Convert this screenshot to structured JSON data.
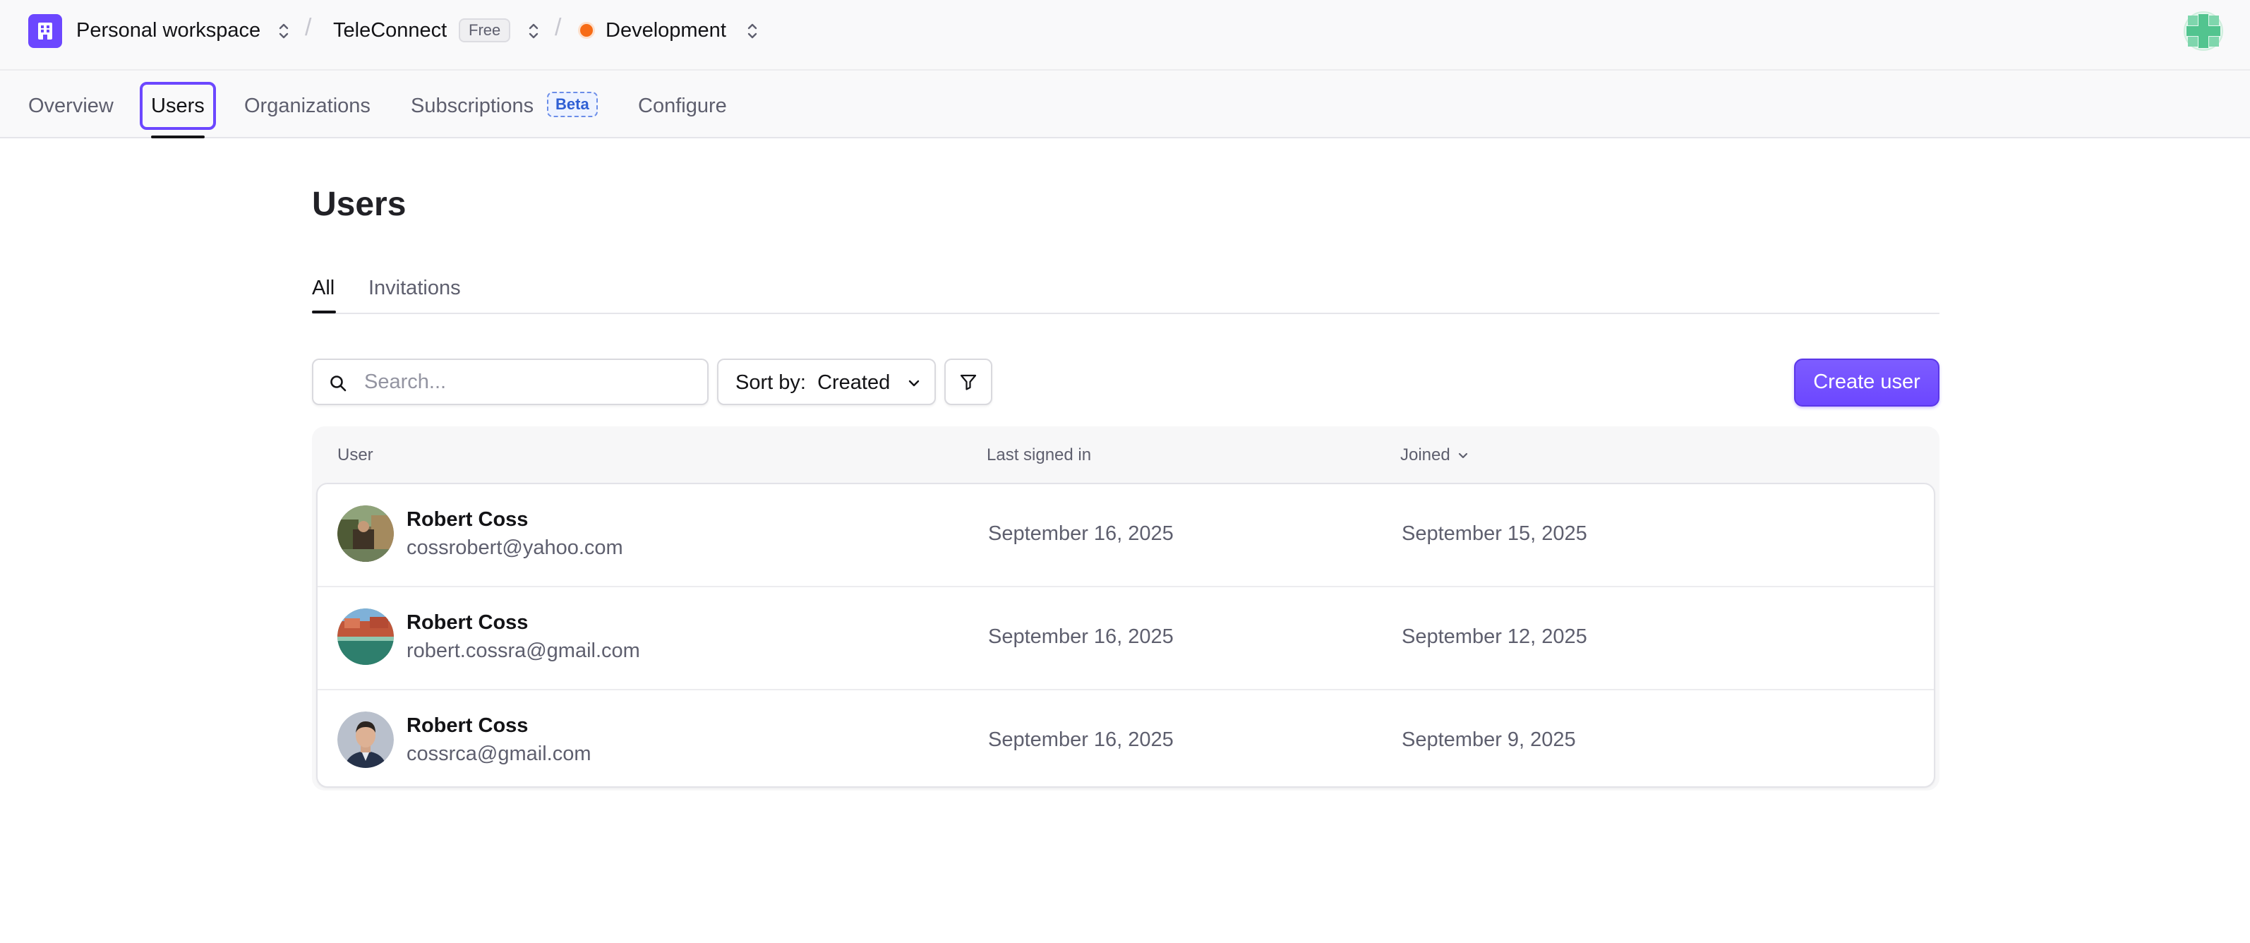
{
  "topbar": {
    "workspace": "Personal workspace",
    "app": "TeleConnect",
    "app_plan": "Free",
    "environment": "Development",
    "separator": "/"
  },
  "nav": {
    "items": [
      {
        "label": "Overview"
      },
      {
        "label": "Users"
      },
      {
        "label": "Organizations"
      },
      {
        "label": "Subscriptions",
        "badge": "Beta"
      },
      {
        "label": "Configure"
      }
    ],
    "active": "Users"
  },
  "page": {
    "title": "Users",
    "tabs": [
      {
        "label": "All"
      },
      {
        "label": "Invitations"
      }
    ],
    "active_tab": "All"
  },
  "toolbar": {
    "search_placeholder": "Search...",
    "sort_prefix": "Sort by:",
    "sort_value": "Created",
    "create_label": "Create user"
  },
  "table": {
    "headers": {
      "user": "User",
      "last_signed_in": "Last signed in",
      "joined": "Joined"
    },
    "rows": [
      {
        "name": "Robert Coss",
        "email": "cossrobert@yahoo.com",
        "last_signed_in": "September 16, 2025",
        "joined": "September 15, 2025"
      },
      {
        "name": "Robert Coss",
        "email": "robert.cossra@gmail.com",
        "last_signed_in": "September 16, 2025",
        "joined": "September 12, 2025"
      },
      {
        "name": "Robert Coss",
        "email": "cossrca@gmail.com",
        "last_signed_in": "September 16, 2025",
        "joined": "September 9, 2025"
      }
    ]
  },
  "colors": {
    "accent": "#6c47ff",
    "env_dot": "#f76b15",
    "beta": "#2f5fd4"
  }
}
